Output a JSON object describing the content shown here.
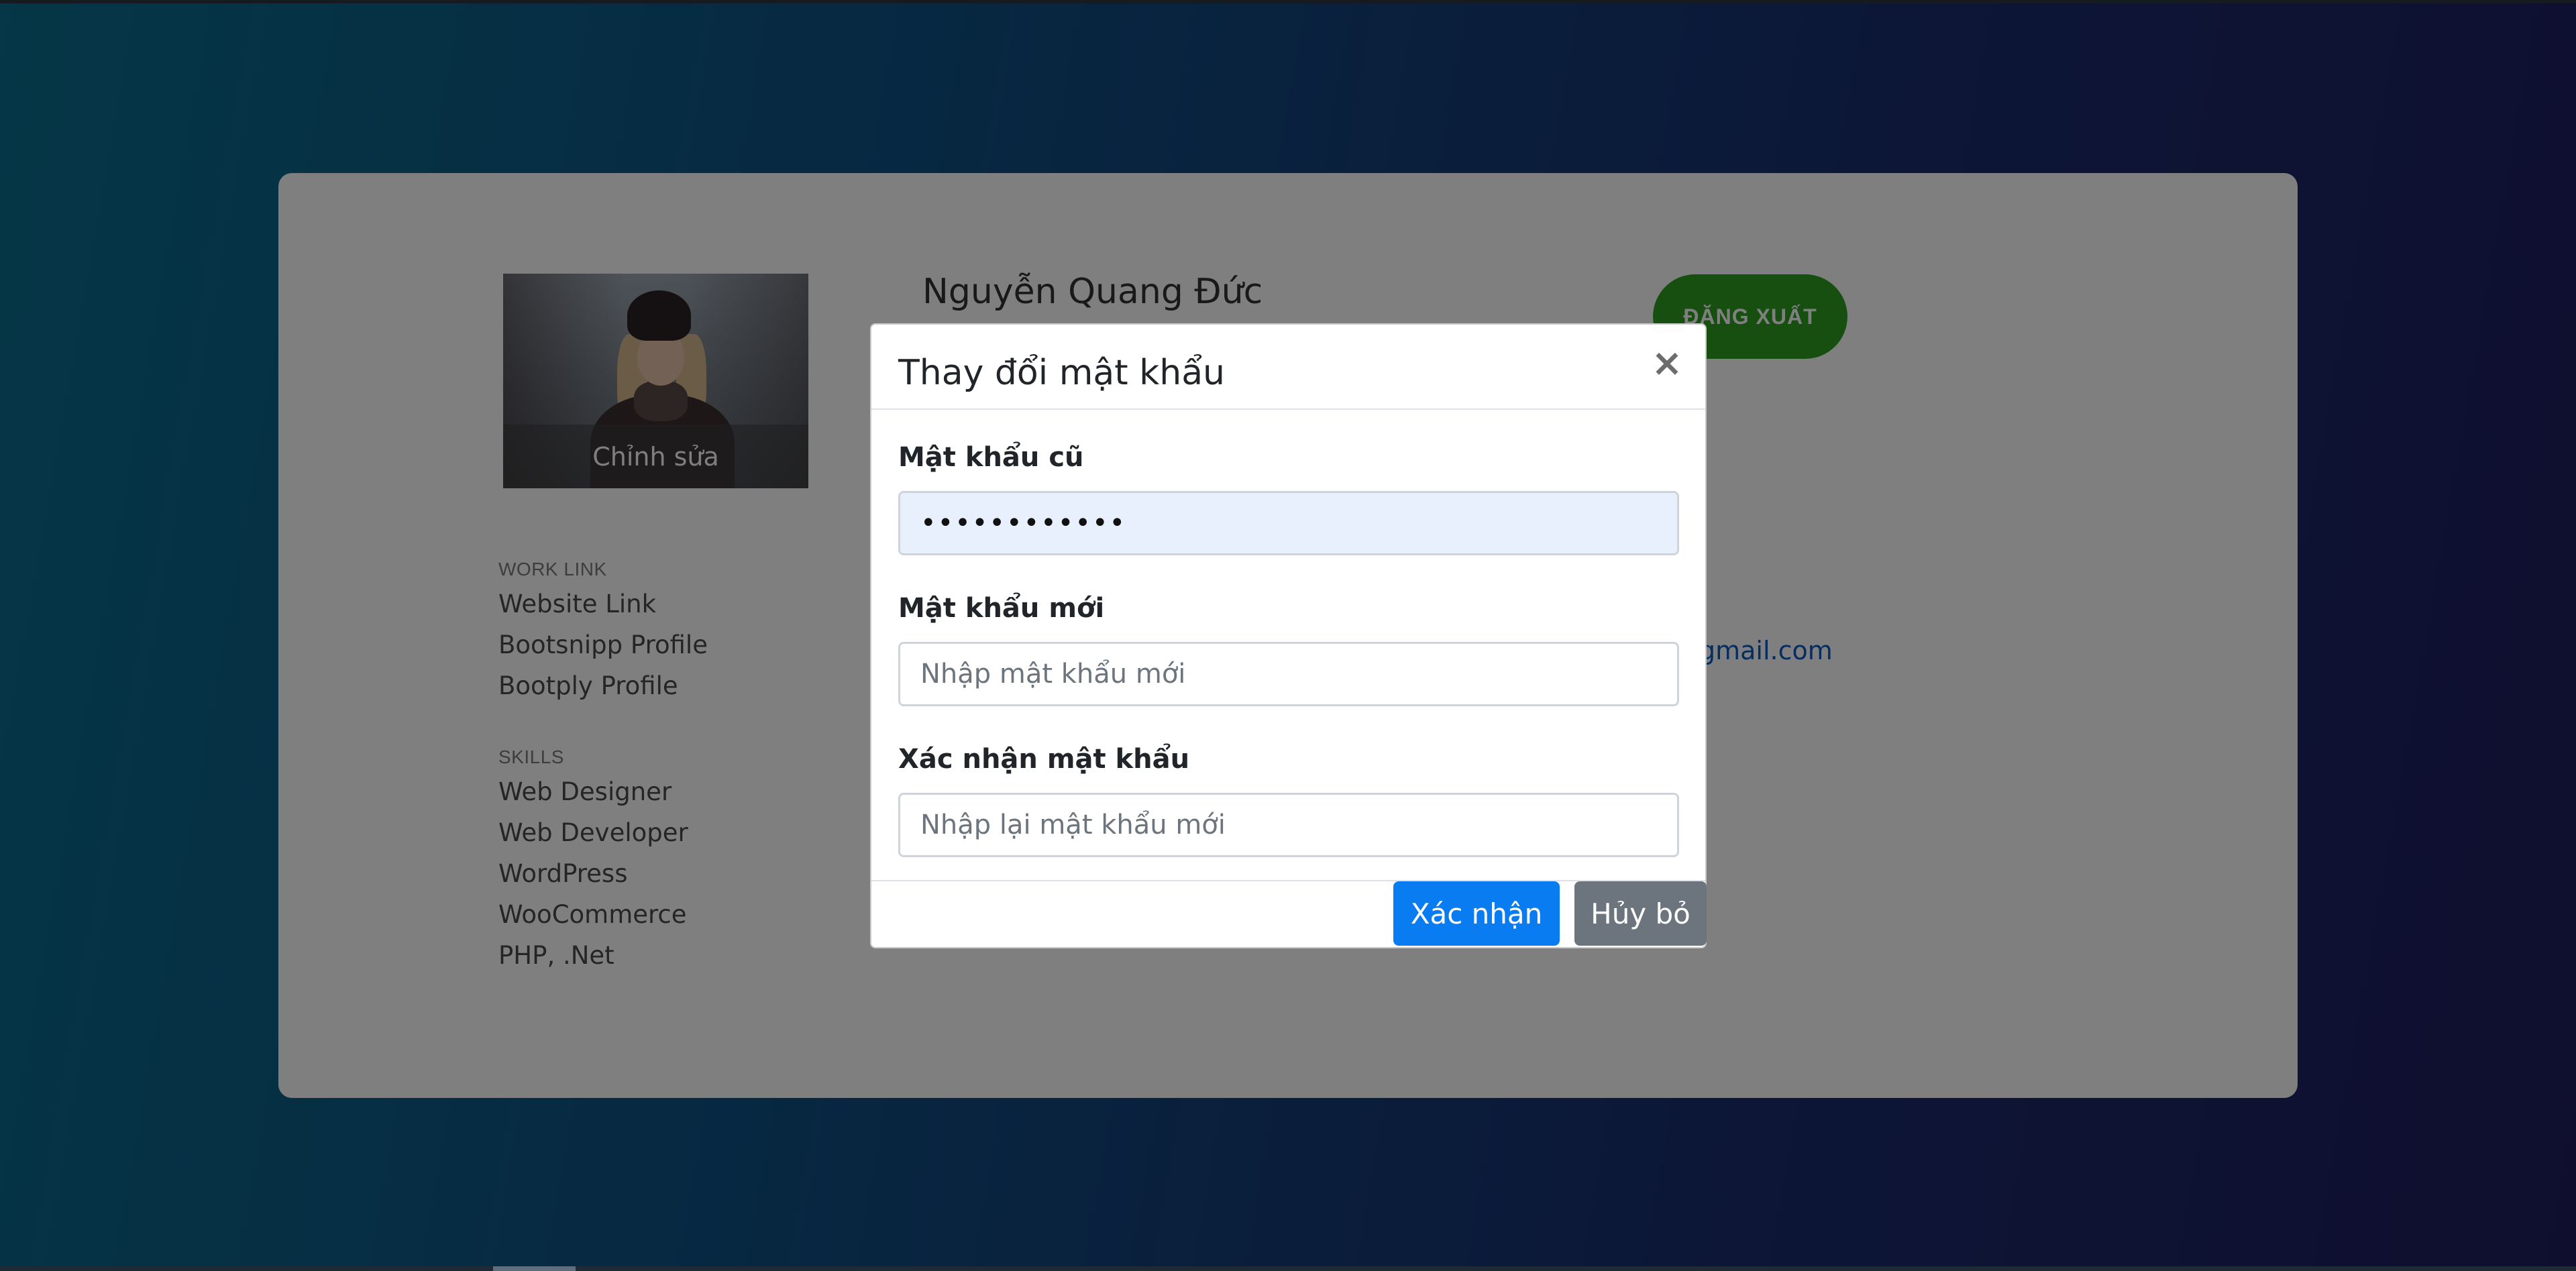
{
  "colors": {
    "primary": "#0a7cf2",
    "secondary": "#6c757d",
    "success": "#2e9e23",
    "link": "#0c5bbf"
  },
  "profile": {
    "name": "Nguyễn Quang Đức",
    "email_partial": "gmail.com",
    "avatar_edit_label": "Chỉnh sửa",
    "logout_label": "ĐĂNG XUẤT"
  },
  "sidebar": {
    "work_link": {
      "title": "WORK LINK",
      "items": [
        "Website Link",
        "Bootsnipp Profile",
        "Bootply Profile"
      ]
    },
    "skills": {
      "title": "SKILLS",
      "items": [
        "Web Designer",
        "Web Developer",
        "WordPress",
        "WooCommerce",
        "PHP, .Net"
      ]
    }
  },
  "modal": {
    "title": "Thay đổi mật khẩu",
    "close_icon": "×",
    "fields": {
      "old_password": {
        "label": "Mật khẩu cũ",
        "value": "••••••••••••"
      },
      "new_password": {
        "label": "Mật khẩu mới",
        "placeholder": "Nhập mật khẩu mới"
      },
      "confirm_password": {
        "label": "Xác nhận mật khẩu",
        "placeholder": "Nhập lại mật khẩu mới"
      }
    },
    "confirm_label": "Xác nhận",
    "cancel_label": "Hủy bỏ"
  }
}
